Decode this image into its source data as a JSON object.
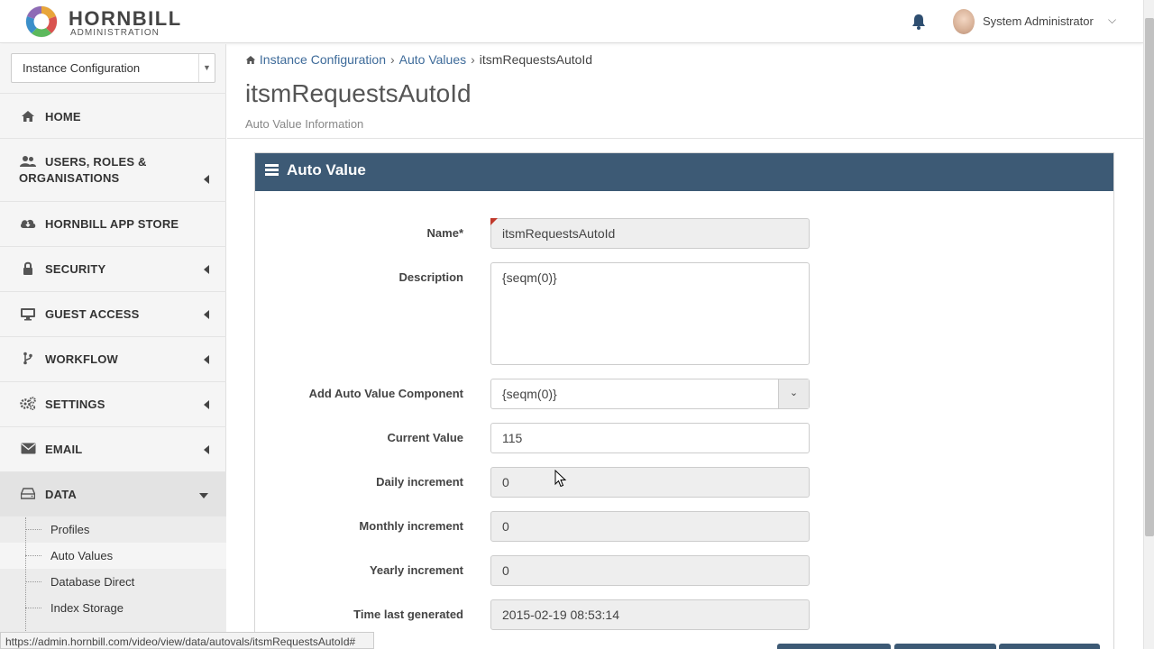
{
  "header": {
    "brand": "HORNBILL",
    "brand_sub": "ADMINISTRATION",
    "user_name": "System Administrator"
  },
  "sidebar": {
    "context_select": "Instance Configuration",
    "items": [
      {
        "label": "HOME",
        "icon": "home-icon"
      },
      {
        "label": "USERS, ROLES &",
        "label2": "ORGANISATIONS",
        "icon": "users-icon"
      },
      {
        "label": "HORNBILL APP STORE",
        "icon": "cloud-download-icon"
      },
      {
        "label": "SECURITY",
        "icon": "lock-icon"
      },
      {
        "label": "GUEST ACCESS",
        "icon": "desktop-icon"
      },
      {
        "label": "WORKFLOW",
        "icon": "branch-icon"
      },
      {
        "label": "SETTINGS",
        "icon": "gears-icon"
      },
      {
        "label": "EMAIL",
        "icon": "envelope-icon"
      },
      {
        "label": "DATA",
        "icon": "hdd-icon"
      }
    ],
    "data_subitems": [
      "Profiles",
      "Auto Values",
      "Database Direct",
      "Index Storage"
    ]
  },
  "breadcrumb": {
    "home": "Instance Configuration",
    "level2": "Auto Values",
    "current": "itsmRequestsAutoId"
  },
  "page": {
    "title": "itsmRequestsAutoId",
    "subtitle": "Auto Value Information"
  },
  "panel": {
    "title": "Auto Value"
  },
  "form": {
    "name_label": "Name*",
    "name_value": "itsmRequestsAutoId",
    "description_label": "Description",
    "description_value": "{seqm(0)}",
    "component_label": "Add Auto Value Component",
    "component_value": "{seqm(0)}",
    "current_label": "Current Value",
    "current_value": "115",
    "daily_label": "Daily increment",
    "daily_value": "0",
    "monthly_label": "Monthly increment",
    "monthly_value": "0",
    "yearly_label": "Yearly increment",
    "yearly_value": "0",
    "last_label": "Time last generated",
    "last_value": "2015-02-19 08:53:14"
  },
  "status_bar": {
    "url": "https://admin.hornbill.com/video/view/data/autovals/itsmRequestsAutoId#"
  },
  "colors": {
    "panel_header": "#3d5a75",
    "link": "#3e6b9a",
    "required_flag": "#c0392b"
  }
}
